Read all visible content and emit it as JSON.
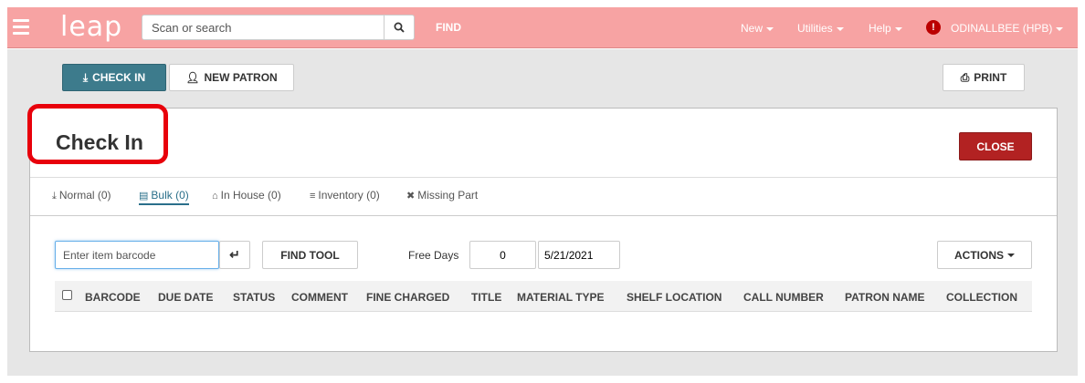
{
  "navbar": {
    "logo": "leap",
    "search_placeholder": "Scan or search",
    "find_label": "FIND",
    "menus": [
      "New",
      "Utilities",
      "Help"
    ],
    "user_label": "ODINALLBEE (HPB)"
  },
  "toolbar": {
    "checkin_label": "CHECK IN",
    "new_patron_label": "NEW PATRON",
    "print_label": "PRINT"
  },
  "panel": {
    "title": "Check In",
    "close_label": "CLOSE"
  },
  "tabs": [
    {
      "label": "Normal (0)",
      "icon": "download-icon"
    },
    {
      "label": "Bulk (0)",
      "icon": "bulk-icon",
      "active": true
    },
    {
      "label": "In House (0)",
      "icon": "home-icon"
    },
    {
      "label": "Inventory (0)",
      "icon": "layers-icon"
    },
    {
      "label": "Missing Part",
      "icon": "puzzle-icon"
    }
  ],
  "controls": {
    "barcode_placeholder": "Enter item barcode",
    "find_tool_label": "FIND TOOL",
    "free_days_label": "Free Days",
    "free_days_value": "0",
    "date_value": "5/21/2021",
    "actions_label": "ACTIONS"
  },
  "table": {
    "columns": [
      "BARCODE",
      "DUE DATE",
      "STATUS",
      "COMMENT",
      "FINE CHARGED",
      "TITLE",
      "MATERIAL TYPE",
      "SHELF LOCATION",
      "CALL NUMBER",
      "PATRON NAME",
      "COLLECTION"
    ]
  },
  "colors": {
    "navbar": "#f7a3a3",
    "checkin_button": "#3d7b8c",
    "close_button": "#b22222",
    "highlight": "#e8000b"
  }
}
